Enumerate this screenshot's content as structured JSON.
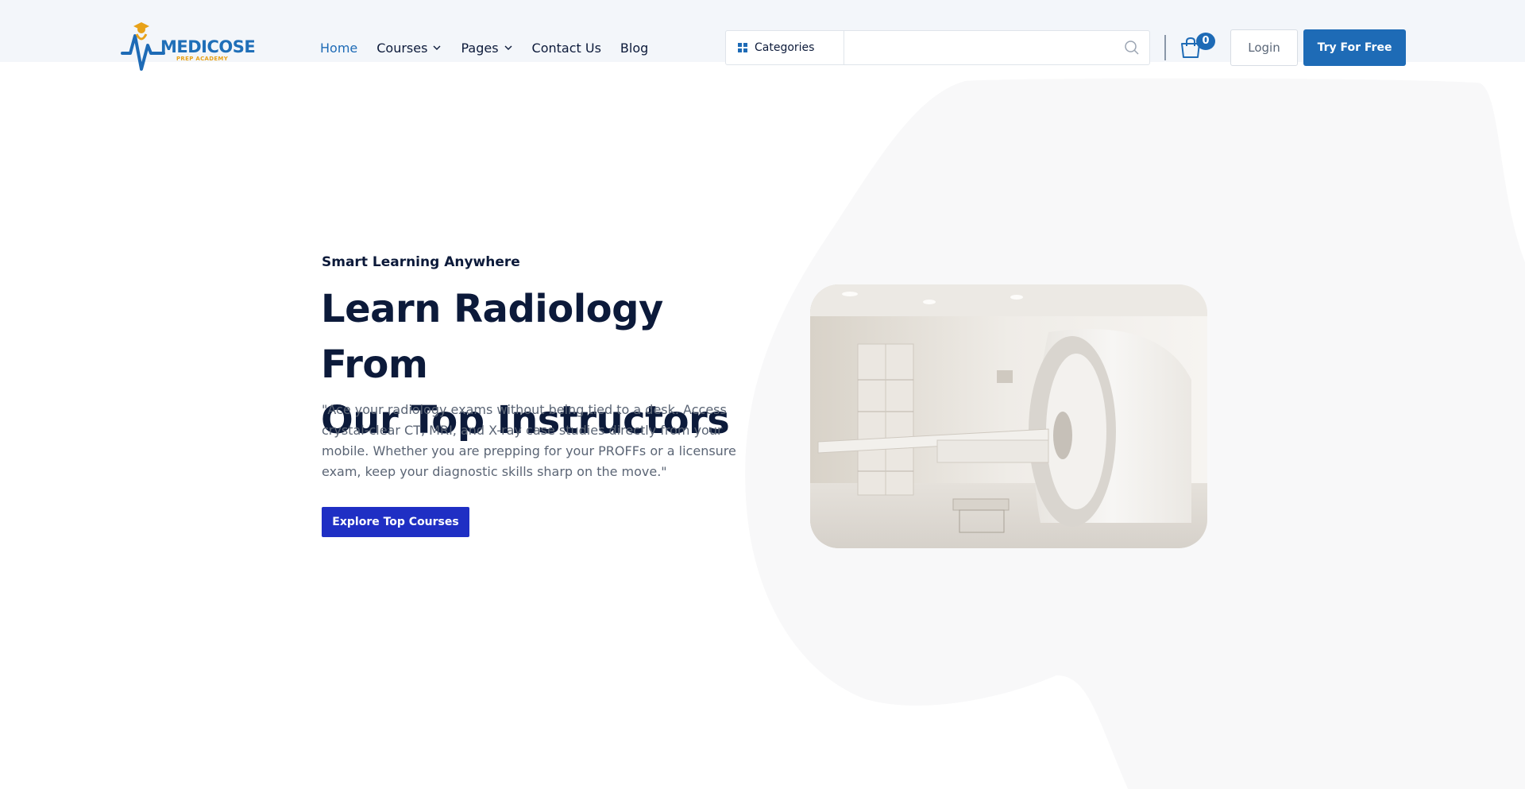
{
  "brand": {
    "name": "MEDICOSE",
    "tagline": "PREP ACADEMY",
    "colors": {
      "primary": "#1e6bb6",
      "accent": "#e8a219",
      "cta": "#1f2fc4"
    }
  },
  "nav": {
    "items": [
      {
        "label": "Home",
        "active": true,
        "has_dropdown": false
      },
      {
        "label": "Courses",
        "active": false,
        "has_dropdown": true
      },
      {
        "label": "Pages",
        "active": false,
        "has_dropdown": true
      },
      {
        "label": "Contact Us",
        "active": false,
        "has_dropdown": false
      },
      {
        "label": "Blog",
        "active": false,
        "has_dropdown": false
      }
    ]
  },
  "header": {
    "categories_label": "Categories",
    "search": {
      "value": "",
      "placeholder": ""
    },
    "cart": {
      "count": "0",
      "icon": "shopping-bag-icon"
    },
    "login_label": "Login",
    "try_label": "Try For Free"
  },
  "hero": {
    "eyebrow": "Smart Learning Anywhere",
    "title_line1": "Learn Radiology From",
    "title_line2": "Our Top Instructors",
    "description": "\"Ace your radiology exams without being tied to a desk. Access crystal-clear CT, MRI, and X-ray case studies directly from your mobile. Whether you are prepping for your PROFFs or a licensure exam, keep your diagnostic skills sharp on the move.\"",
    "cta_label": "Explore Top Courses"
  }
}
